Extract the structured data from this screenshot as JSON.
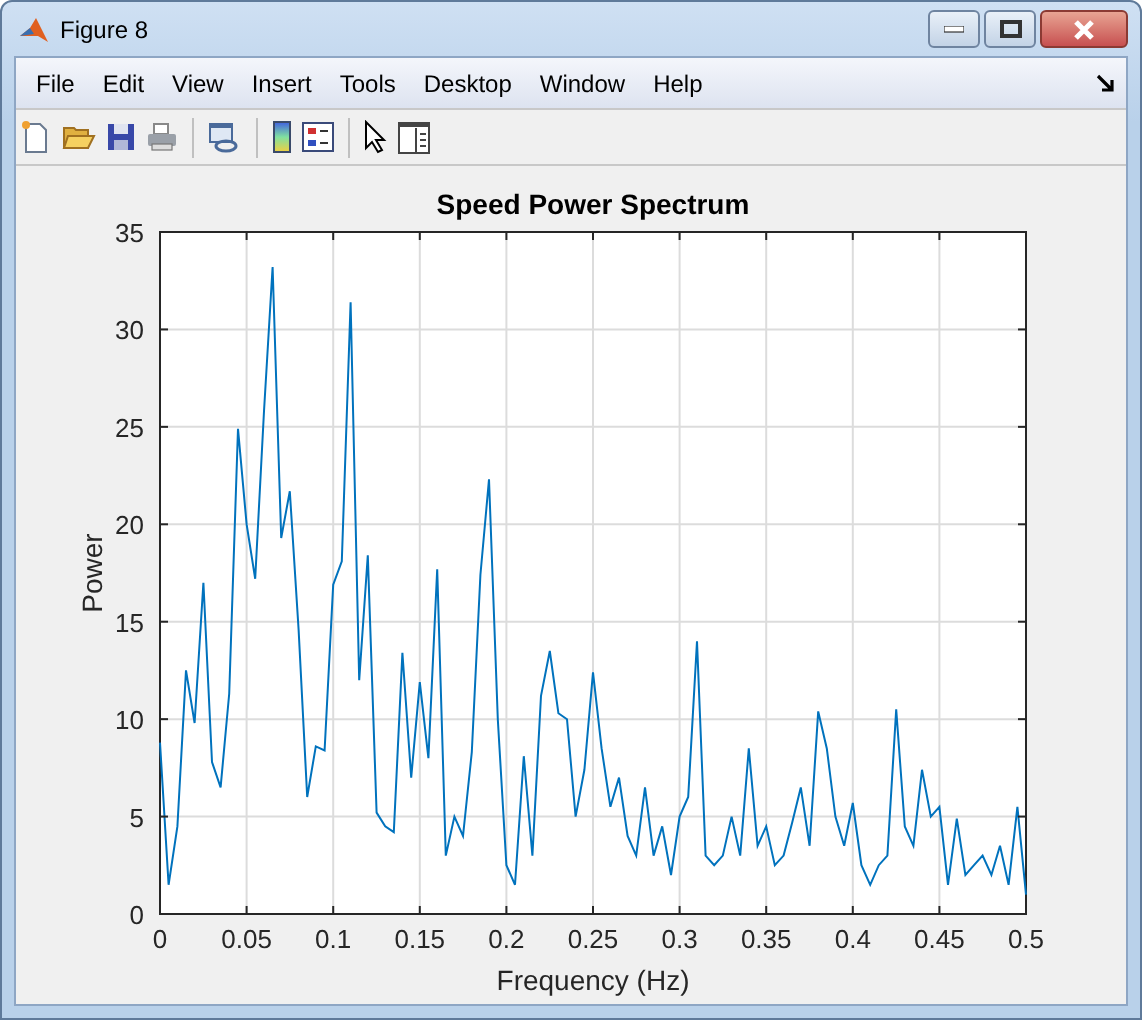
{
  "window": {
    "title": "Figure 8"
  },
  "menu": [
    "File",
    "Edit",
    "View",
    "Insert",
    "Tools",
    "Desktop",
    "Window",
    "Help"
  ],
  "figure": {
    "chart_data": {
      "type": "line",
      "title": "Speed Power Spectrum",
      "xlabel": "Frequency (Hz)",
      "ylabel": "Power",
      "x": [
        0,
        0.005,
        0.01,
        0.015,
        0.02,
        0.025,
        0.03,
        0.035,
        0.04,
        0.045,
        0.05,
        0.055,
        0.06,
        0.065,
        0.07,
        0.075,
        0.08,
        0.085,
        0.09,
        0.095,
        0.1,
        0.105,
        0.11,
        0.115,
        0.12,
        0.125,
        0.13,
        0.135,
        0.14,
        0.145,
        0.15,
        0.155,
        0.16,
        0.165,
        0.17,
        0.175,
        0.18,
        0.185,
        0.19,
        0.195,
        0.2,
        0.205,
        0.21,
        0.215,
        0.22,
        0.225,
        0.23,
        0.235,
        0.24,
        0.245,
        0.25,
        0.255,
        0.26,
        0.265,
        0.27,
        0.275,
        0.28,
        0.285,
        0.29,
        0.295,
        0.3,
        0.305,
        0.31,
        0.315,
        0.32,
        0.325,
        0.33,
        0.335,
        0.34,
        0.345,
        0.35,
        0.355,
        0.36,
        0.365,
        0.37,
        0.375,
        0.38,
        0.385,
        0.39,
        0.395,
        0.4,
        0.405,
        0.41,
        0.415,
        0.42,
        0.425,
        0.43,
        0.435,
        0.44,
        0.445,
        0.45,
        0.455,
        0.46,
        0.465,
        0.47,
        0.475,
        0.48,
        0.485,
        0.49,
        0.495,
        0.5
      ],
      "series": [
        {
          "color": "#0072bd",
          "values": [
            8.8,
            1.5,
            4.5,
            12.5,
            9.8,
            17,
            7.8,
            6.5,
            11.3,
            24.9,
            20,
            17.2,
            25.8,
            33.2,
            19.3,
            21.7,
            14.6,
            6,
            8.6,
            8.4,
            16.9,
            18.1,
            31.4,
            12,
            18.4,
            5.2,
            4.5,
            4.2,
            13.4,
            7,
            11.9,
            8,
            17.7,
            3,
            5,
            4,
            8.3,
            17.4,
            22.3,
            10,
            2.5,
            1.5,
            8.1,
            3,
            11.2,
            13.5,
            10.3,
            10,
            5,
            7.4,
            12.4,
            8.5,
            5.5,
            7,
            4,
            3,
            6.5,
            3,
            4.5,
            2,
            5,
            6,
            14,
            3,
            2.5,
            3,
            5,
            3,
            8.5,
            3.5,
            4.5,
            2.5,
            3,
            4.7,
            6.5,
            3.5,
            10.4,
            8.5,
            5,
            3.5,
            5.7,
            2.5,
            1.5,
            2.5,
            3,
            10.5,
            4.5,
            3.5,
            7.4,
            5,
            5.5,
            1.5,
            4.9,
            2,
            2.5,
            3,
            2,
            3.5,
            1.5,
            5.5,
            1
          ]
        }
      ],
      "xlim": [
        0,
        0.5
      ],
      "ylim": [
        0,
        35
      ],
      "grid": true,
      "xticks": [
        0,
        0.05,
        0.1,
        0.15,
        0.2,
        0.25,
        0.3,
        0.35,
        0.4,
        0.45,
        0.5
      ],
      "yticks": [
        0,
        5,
        10,
        15,
        20,
        25,
        30,
        35
      ]
    }
  }
}
